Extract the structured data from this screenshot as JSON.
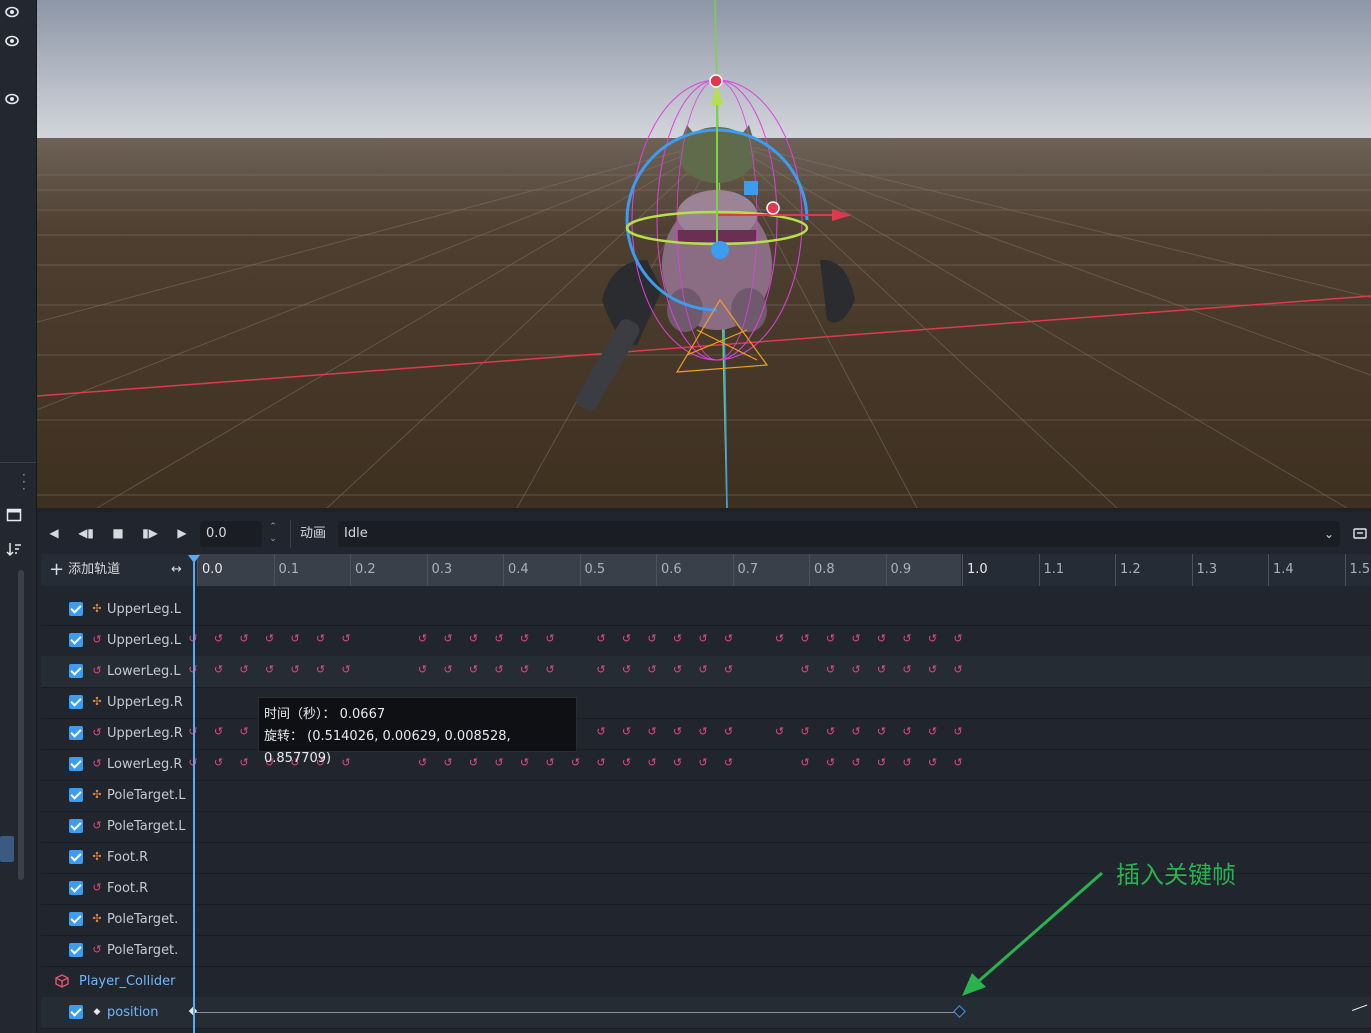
{
  "toolbar": {
    "time_value": "0.0",
    "anim_label": "动画",
    "animation_name": "Idle"
  },
  "header": {
    "add_track_label": "添加轨道",
    "ticks": [
      "0.0",
      "0.1",
      "0.2",
      "0.3",
      "0.4",
      "0.5",
      "0.6",
      "0.7",
      "0.8",
      "0.9",
      "1.0",
      "1.1",
      "1.2",
      "1.3",
      "1.4",
      "1.5"
    ]
  },
  "tracks": [
    {
      "name": "UpperLeg.L",
      "type": "position"
    },
    {
      "name": "UpperLeg.L",
      "type": "rotation"
    },
    {
      "name": "LowerLeg.L",
      "type": "rotation"
    },
    {
      "name": "UpperLeg.R",
      "type": "position"
    },
    {
      "name": "UpperLeg.R",
      "type": "rotation"
    },
    {
      "name": "LowerLeg.R",
      "type": "rotation"
    },
    {
      "name": "PoleTarget.L",
      "type": "position"
    },
    {
      "name": "PoleTarget.L",
      "type": "rotation"
    },
    {
      "name": "Foot.R",
      "type": "position"
    },
    {
      "name": "Foot.R",
      "type": "rotation"
    },
    {
      "name": "PoleTarget.",
      "type": "position"
    },
    {
      "name": "PoleTarget.",
      "type": "rotation"
    }
  ],
  "node": {
    "name": "Player_Collider"
  },
  "property_track": {
    "name": "position"
  },
  "tooltip": {
    "line1": "时间（秒）： 0.0667",
    "line2": "旋转： (0.514026, 0.00629, 0.008528, 0.857709)"
  },
  "annotation": {
    "text": "插入关键帧"
  },
  "colors": {
    "accent": "#3b9cf0",
    "rotation_key": "#e24a84",
    "position_key": "#e0873a",
    "annotation": "#2ab24e"
  }
}
